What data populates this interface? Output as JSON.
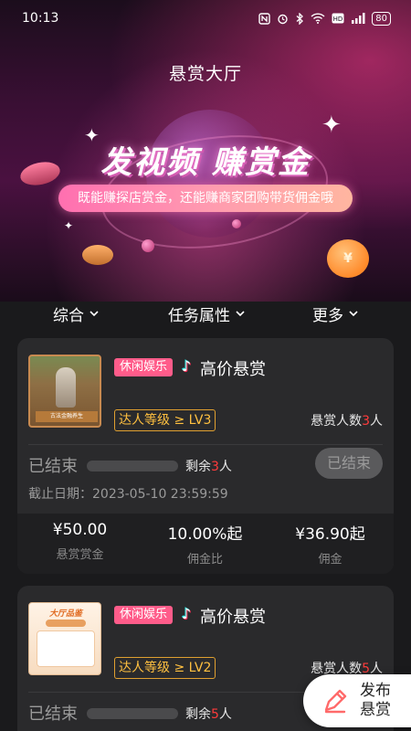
{
  "status_bar": {
    "time": "10:13",
    "icons": [
      "nfc-icon",
      "alarm-icon",
      "bluetooth-icon",
      "wifi-icon",
      "hd-icon",
      "signal-icon"
    ],
    "battery": "80"
  },
  "header": {
    "title": "悬赏大厅"
  },
  "banner": {
    "slogan": "发视频 赚赏金",
    "subtitle": "既能赚探店赏金，还能赚商家团购带货佣金哦",
    "coin_symbol": "¥"
  },
  "filters": [
    {
      "label": "综合"
    },
    {
      "label": "任务属性"
    },
    {
      "label": "更多"
    }
  ],
  "cards": [
    {
      "category": "休闲娱乐",
      "title": "高价悬赏",
      "thumb_caption": "古法金融养生",
      "level": "达人等级 ≥ LV3",
      "reward_count_prefix": "悬赏人数",
      "reward_count_value": "3",
      "reward_count_suffix": "人",
      "status": "已结束",
      "progress": 0,
      "remain_prefix": "剩余",
      "remain_value": "3",
      "remain_suffix": "人",
      "button": "已结束",
      "deadline": "截止日期：2023-05-10 23:59:59",
      "stats": [
        {
          "value": "¥50.00",
          "label": "悬赏赏金"
        },
        {
          "value": "10.00%起",
          "label": "佣金比"
        },
        {
          "value": "¥36.90起",
          "label": "佣金"
        }
      ]
    },
    {
      "category": "休闲娱乐",
      "title": "高价悬赏",
      "thumb_caption": "大厅品鉴",
      "level": "达人等级 ≥ LV2",
      "reward_count_prefix": "悬赏人数",
      "reward_count_value": "5",
      "reward_count_suffix": "人",
      "status": "已结束",
      "progress": 0,
      "remain_prefix": "剩余",
      "remain_value": "5",
      "remain_suffix": "人"
    }
  ],
  "fab": {
    "label": "发布悬赏"
  },
  "colors": {
    "accent_red": "#ff3b3b",
    "tag_pink": "#ff5c8a",
    "level_gold": "#ffc040"
  }
}
